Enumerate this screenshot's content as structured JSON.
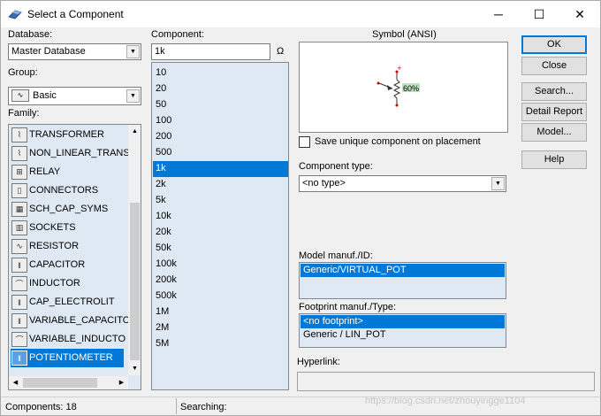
{
  "window": {
    "title": "Select a Component",
    "min_glyph": "─",
    "max_glyph": "☐",
    "close_glyph": "✕"
  },
  "database": {
    "label": "Database:",
    "value": "Master Database"
  },
  "group": {
    "label": "Group:",
    "value": "Basic"
  },
  "family": {
    "label": "Family:",
    "items": [
      {
        "label": "TRANSFORMER",
        "icon": "transformer-icon",
        "glyph": "⌇"
      },
      {
        "label": "NON_LINEAR_TRANS",
        "icon": "nonlinear-transformer-icon",
        "glyph": "⌇"
      },
      {
        "label": "RELAY",
        "icon": "relay-icon",
        "glyph": "⊞"
      },
      {
        "label": "CONNECTORS",
        "icon": "connector-icon",
        "glyph": "▯"
      },
      {
        "label": "SCH_CAP_SYMS",
        "icon": "schematic-symbols-icon",
        "glyph": "▦"
      },
      {
        "label": "SOCKETS",
        "icon": "socket-icon",
        "glyph": "▥"
      },
      {
        "label": "RESISTOR",
        "icon": "resistor-icon",
        "glyph": "∿"
      },
      {
        "label": "CAPACITOR",
        "icon": "capacitor-icon",
        "glyph": "‖"
      },
      {
        "label": "INDUCTOR",
        "icon": "inductor-icon",
        "glyph": "⌒"
      },
      {
        "label": "CAP_ELECTROLIT",
        "icon": "electrolytic-capacitor-icon",
        "glyph": "‖"
      },
      {
        "label": "VARIABLE_CAPACITO",
        "icon": "variable-capacitor-icon",
        "glyph": "‖"
      },
      {
        "label": "VARIABLE_INDUCTO",
        "icon": "variable-inductor-icon",
        "glyph": "⌒"
      },
      {
        "label": "POTENTIOMETER",
        "icon": "potentiometer-icon",
        "glyph": "‖"
      }
    ],
    "selected_index": 12
  },
  "component": {
    "label": "Component:",
    "value": "1k",
    "unit": "Ω",
    "items": [
      "10",
      "20",
      "50",
      "100",
      "200",
      "500",
      "1k",
      "2k",
      "5k",
      "10k",
      "20k",
      "50k",
      "100k",
      "200k",
      "500k",
      "1M",
      "2M",
      "5M"
    ],
    "selected_index": 6
  },
  "symbol": {
    "label": "Symbol (ANSI)",
    "percent_label": "60%"
  },
  "save_unique": {
    "label": "Save unique component on placement",
    "checked": false
  },
  "component_type": {
    "label": "Component type:",
    "value": "<no type>"
  },
  "model": {
    "label": "Model manuf./ID:",
    "items": [
      "Generic/VIRTUAL_POT"
    ],
    "selected_index": 0
  },
  "footprint": {
    "label": "Footprint manuf./Type:",
    "items": [
      "<no footprint>",
      "Generic / LIN_POT"
    ],
    "selected_index": 0
  },
  "hyperlink": {
    "label": "Hyperlink:",
    "value": ""
  },
  "buttons": {
    "ok": "OK",
    "close": "Close",
    "search": "Search...",
    "detail_report": "Detail Report",
    "model": "Model...",
    "help": "Help"
  },
  "status": {
    "components": "Components: 18",
    "searching": "Searching:"
  },
  "watermark": "https://blog.csdn.net/zhouyingge1104"
}
